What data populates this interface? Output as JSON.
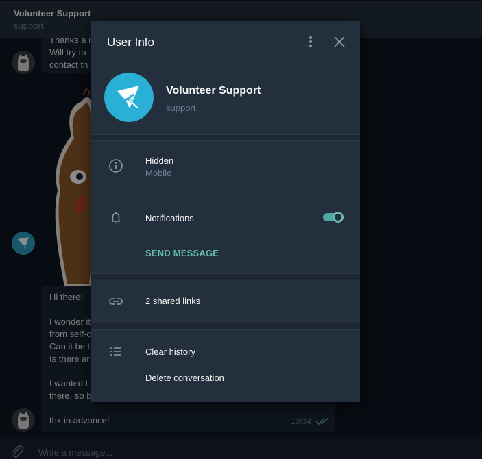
{
  "chat_header": {
    "title": "Volunteer Support",
    "subtitle": "support"
  },
  "messages": {
    "top_lines": [
      "Thanks a l",
      "Will try to",
      "contact th"
    ],
    "bottom_lines": [
      "Hi there!",
      "",
      "I wonder it",
      "from self-c",
      "Can it be t",
      "Is there ar",
      "",
      "I wanted t",
      "there, so b",
      "",
      "thx in advance!"
    ],
    "time": "10:34"
  },
  "input": {
    "placeholder": "Write a message..."
  },
  "modal": {
    "title": "User Info",
    "profile": {
      "name": "Volunteer Support",
      "status": "support"
    },
    "info": {
      "title": "Hidden",
      "subtitle": "Mobile"
    },
    "notifications": {
      "label": "Notifications",
      "enabled": true
    },
    "send_message_label": "SEND MESSAGE",
    "shared_links_label": "2 shared links",
    "clear_history_label": "Clear history",
    "delete_conversation_label": "Delete conversation"
  },
  "icons": {
    "more": "more-vertical-icon",
    "close": "close-icon",
    "info": "info-icon",
    "notifications": "bell-icon",
    "links": "link-icon",
    "actions": "list-icon",
    "attach": "paperclip-icon"
  },
  "colors": {
    "accent": "#64b9ae",
    "avatar": "#2ab0d6",
    "modal_bg": "#242f3d"
  }
}
